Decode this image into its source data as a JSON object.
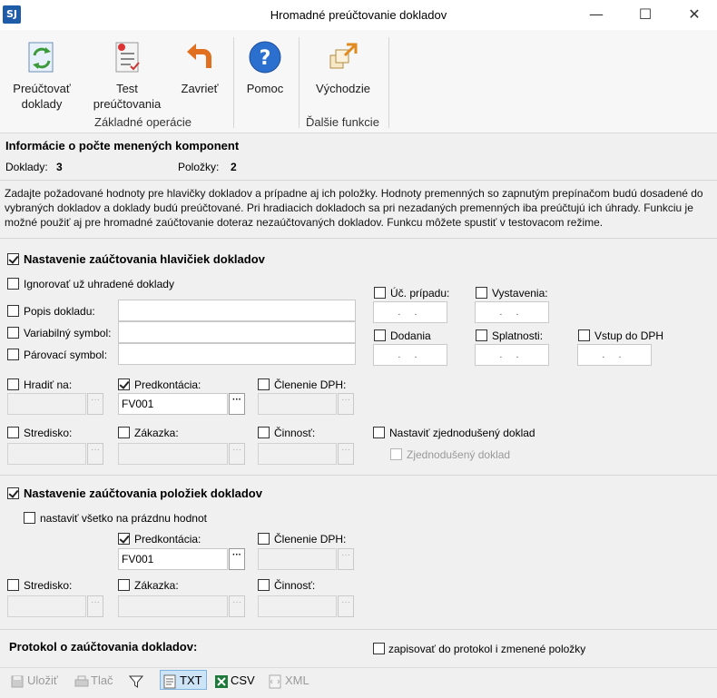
{
  "window": {
    "app_badge": "SJ",
    "title": "Hromadné preúčtovanie dokladov",
    "minimize_glyph": "—",
    "maximize_glyph": "☐",
    "close_glyph": "✕"
  },
  "ribbon": {
    "buttons": [
      {
        "label1": "Preúčtovať",
        "label2": "doklady",
        "icon": "refresh-document-icon"
      },
      {
        "label1": "Test",
        "label2": "preúčtovania",
        "icon": "checklist-document-icon"
      },
      {
        "label1": "Zavrieť",
        "label2": "",
        "icon": "undo-arrow-icon"
      },
      {
        "label1": "Pomoc",
        "label2": "",
        "icon": "help-icon"
      },
      {
        "label1": "Východzie",
        "label2": "",
        "icon": "defaults-icon"
      }
    ],
    "groups": {
      "basic": "Základné operácie",
      "other": "Ďalšie funkcie"
    },
    "help_glyph": "?"
  },
  "info": {
    "heading": "Informácie o počte menených komponent",
    "docs_label": "Doklady:",
    "docs_value": "3",
    "items_label": "Položky:",
    "items_value": "2",
    "description": "Zadajte požadované hodnoty pre hlavičky dokladov a prípadne aj ich položky. Hodnoty premenných so zapnutým prepínačom budú dosadené do vybraných dokladov a doklady budú preúčtované. Pri hradiacich dokladoch sa pri nezadaných premenných iba preúčtujú ich úhrady. Funkciu je možné použiť aj pre hromadné zaúčtovanie doteraz nezaúčtovaných dokladov. Funkcu môžete spustiť v testovacom režime."
  },
  "header_section": {
    "title": "Nastavenie zaúčtovania hlavičiek dokladov",
    "ignore_paid": "Ignorovať už uhradené doklady",
    "doc_description": "Popis dokladu:",
    "variable_symbol": "Variabilný symbol:",
    "pairing_symbol": "Párovací symbol:",
    "case_no": "Úč. prípadu:",
    "issued": "Vystavenia:",
    "delivery": "Dodania",
    "due": "Splatnosti:",
    "vat_entry": "Vstup do DPH",
    "date_placeholder": ". .",
    "pay_to": "Hradiť na:",
    "predkontacia": "Predkontácia:",
    "predkontacia_value": "FV001",
    "vat_breakdown": "Členenie DPH:",
    "center": "Stredisko:",
    "order": "Zákazka:",
    "activity": "Činnosť:",
    "set_simplified": "Nastaviť zjednodušený doklad",
    "simplified": "Zjednodušený doklad",
    "ellipsis": "···"
  },
  "items_section": {
    "title": "Nastavenie zaúčtovania položiek dokladov",
    "set_all_empty": "nastaviť všetko na prázdnu hodnot",
    "predkontacia": "Predkontácia:",
    "predkontacia_value": "FV001",
    "vat_breakdown": "Členenie DPH:",
    "center": "Stredisko:",
    "order": "Zákazka:",
    "activity": "Činnosť:"
  },
  "protocol": {
    "title": "Protokol o zaúčtovania dokladov:",
    "write_changed": "zapisovať do protokol i zmenené položky"
  },
  "toolbar": {
    "save": "Uložiť",
    "print": "Tlač",
    "txt": "TXT",
    "csv": "CSV",
    "xml": "XML"
  }
}
